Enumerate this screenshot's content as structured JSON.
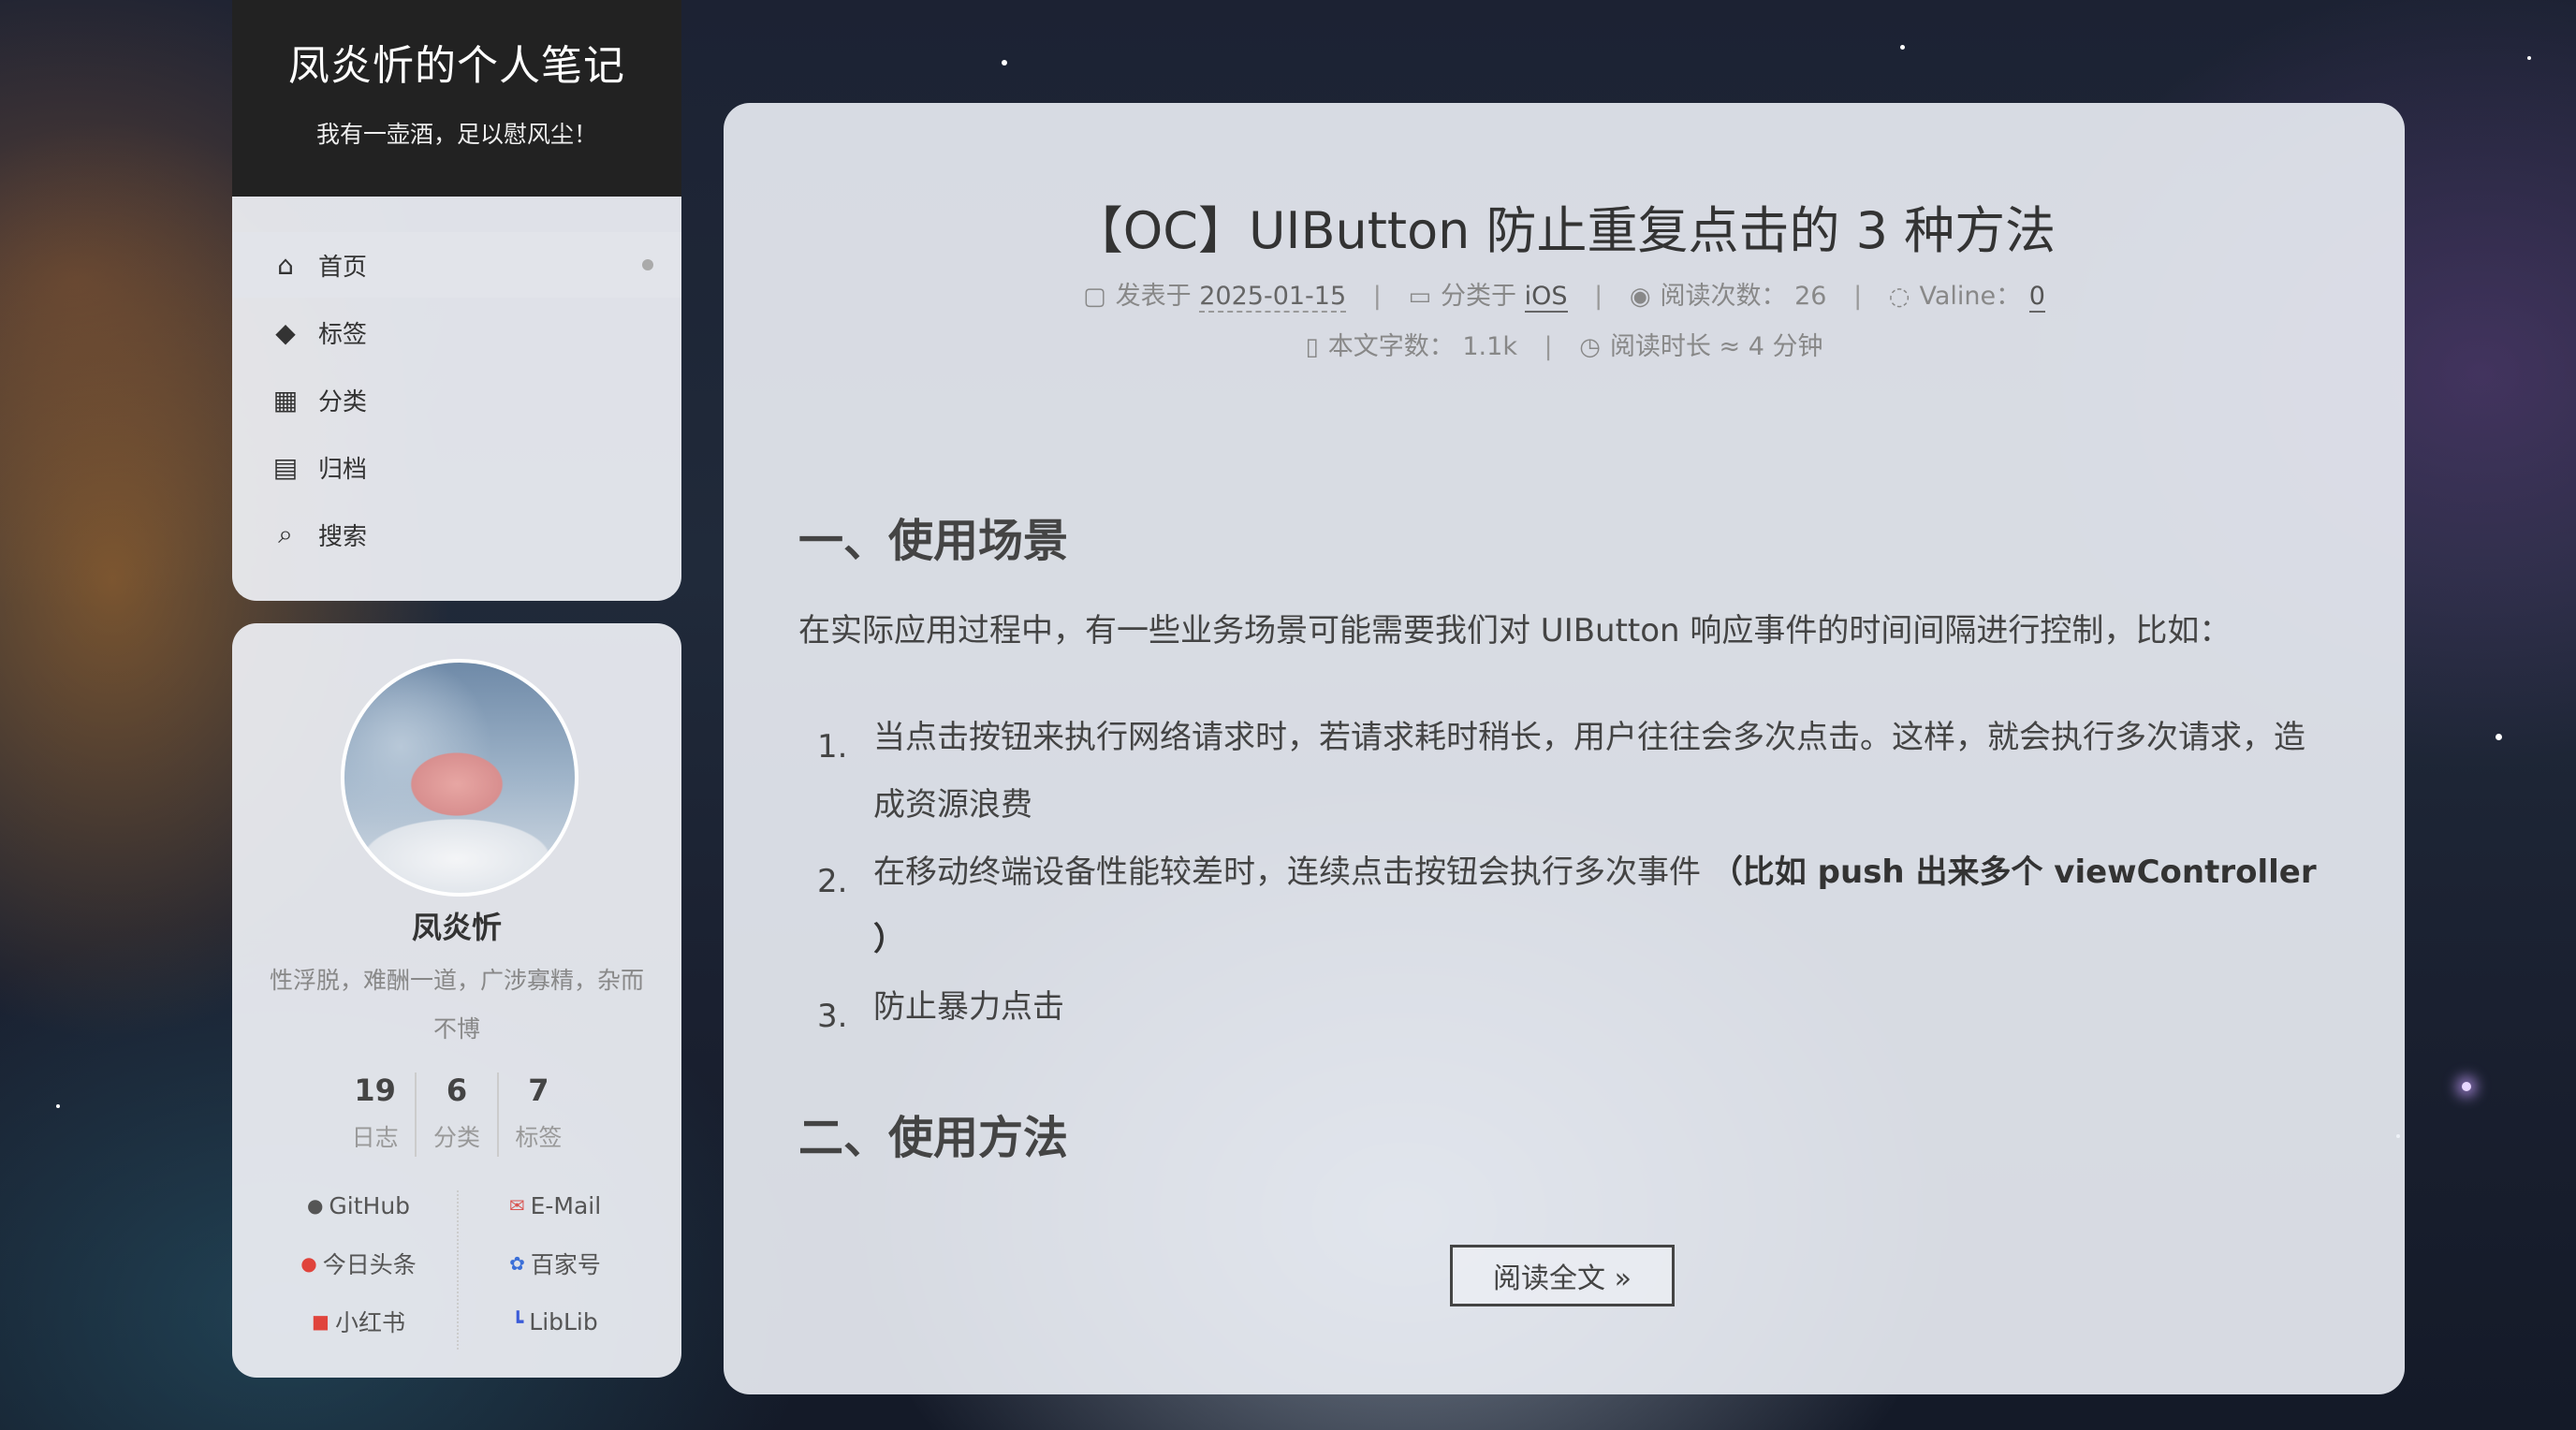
{
  "site": {
    "title": "凤炎忻的个人笔记",
    "subtitle": "我有一壶酒，足以慰风尘！"
  },
  "nav": {
    "items": [
      {
        "label": "首页",
        "icon": "home-icon"
      },
      {
        "label": "标签",
        "icon": "tags-icon"
      },
      {
        "label": "分类",
        "icon": "grid-icon"
      },
      {
        "label": "归档",
        "icon": "archive-icon"
      },
      {
        "label": "搜索",
        "icon": "search-icon"
      }
    ]
  },
  "profile": {
    "name": "凤炎忻",
    "desc": "性浮脱，难酬一道，广涉寡精，杂而不博",
    "stats": [
      {
        "num": "19",
        "label": "日志"
      },
      {
        "num": "6",
        "label": "分类"
      },
      {
        "num": "7",
        "label": "标签"
      }
    ],
    "links": [
      {
        "label": "GitHub",
        "icon": "github-icon"
      },
      {
        "label": "E-Mail",
        "icon": "email-icon"
      },
      {
        "label": "今日头条",
        "icon": "toutiao-icon"
      },
      {
        "label": "百家号",
        "icon": "baijiahao-icon"
      },
      {
        "label": "小红书",
        "icon": "xiaohongshu-icon"
      },
      {
        "label": "LibLib",
        "icon": "liblib-icon"
      }
    ]
  },
  "post": {
    "title": "【OC】UIButton 防止重复点击的 3 种方法",
    "meta": {
      "posted_label": "发表于",
      "posted_date": "2025-01-15",
      "category_label": "分类于",
      "category": "iOS",
      "views_label": "阅读次数：",
      "views": "26",
      "valine_label": "Valine：",
      "valine_count": "0",
      "words_label": "本文字数：",
      "words": "1.1k",
      "read_time_label": "阅读时长 ≈",
      "read_time": "4 分钟"
    },
    "section1": "一、使用场景",
    "intro": "在实际应用过程中，有一些业务场景可能需要我们对 UIButton 响应事件的时间间隔进行控制，比如：",
    "list": [
      {
        "num": "1.",
        "text": "当点击按钮来执行网络请求时，若请求耗时稍长，用户往往会多次点击。这样，就会执行多次请求，造成资源浪费"
      },
      {
        "num": "2.",
        "text": "在移动终端设备性能较差时，连续点击按钮会执行多次事件",
        "bold": "（比如 push 出来多个 viewController ）"
      },
      {
        "num": "3.",
        "text": "防止暴力点击"
      }
    ],
    "section2": "二、使用方法",
    "read_more": "阅读全文 »"
  }
}
